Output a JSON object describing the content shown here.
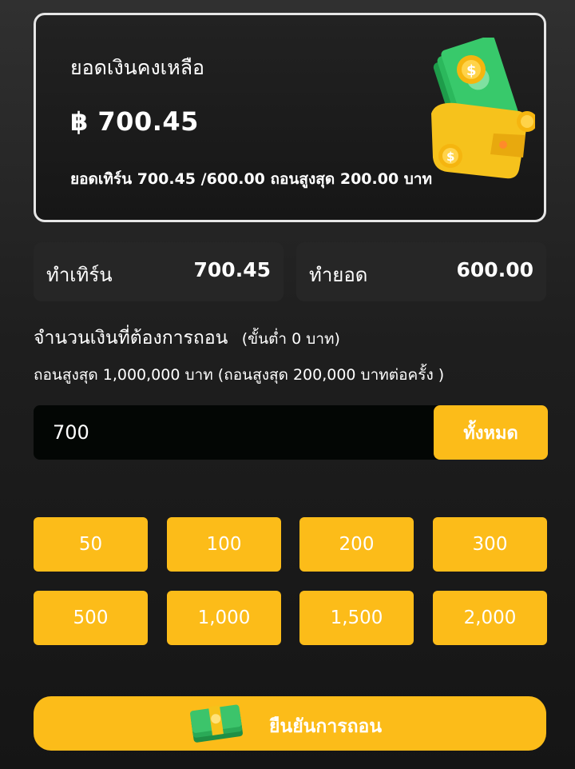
{
  "balance_card": {
    "title": "ยอดเงินคงเหลือ",
    "amount": "฿ 700.45",
    "detail": "ยอดเทิร์น 700.45 /600.00 ถอนสูงสุด 200.00 บาท",
    "illustration": "wallet-with-cash-icon"
  },
  "stats": {
    "turnover_label": "ทำเทิร์น",
    "turnover_value": "700.45",
    "volume_label": "ทำยอด",
    "volume_value": "600.00"
  },
  "withdraw": {
    "heading": "จำนวนเงินที่ต้องการถอน",
    "min_note": "(ขั้นต่ำ 0 บาท)",
    "max_note": "ถอนสูงสุด 1,000,000 บาท (ถอนสูงสุด 200,000 บาทต่อครั้ง )",
    "input_value": "700",
    "all_label": "ทั้งหมด"
  },
  "presets": [
    "50",
    "100",
    "200",
    "300",
    "500",
    "1,000",
    "1,500",
    "2,000"
  ],
  "confirm": {
    "label": "ยืนยันการถอน",
    "icon": "money-stack-icon"
  },
  "colors": {
    "accent": "#fcbc19",
    "card_border": "#e6e6e6",
    "stat_bg": "#262626",
    "input_bg": "#030604"
  }
}
